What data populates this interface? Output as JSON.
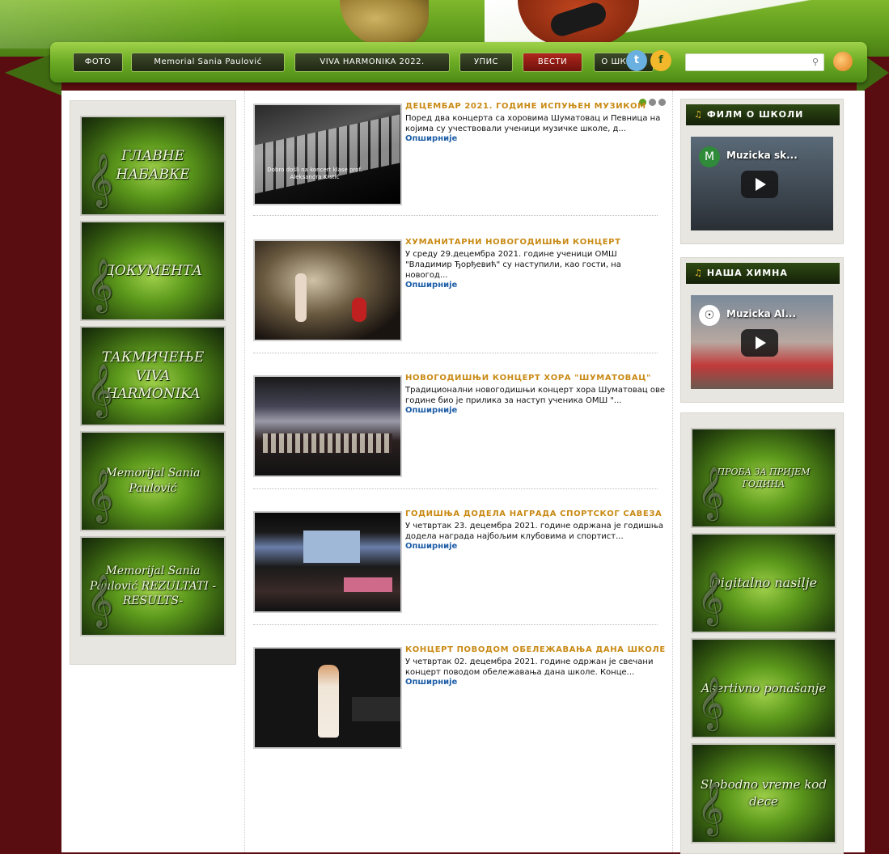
{
  "nav": {
    "items": [
      "ФОТО",
      "Memorial Sania Paulović",
      "VIVA HARMONIKA 2022.",
      "УПИС",
      "ВЕСТИ",
      "О ШКОЛИ"
    ],
    "active_index": 4,
    "search_placeholder": ""
  },
  "left_banners": [
    "ГЛАВНЕ НАБАВКЕ",
    "ДОКУМЕНТА",
    "ТАКМИЧЕЊЕ VIVA HARMONIKA",
    "Memorijal Sania Paulović",
    "Memorijal Sania Paulović REZULTATI -RESULTS-"
  ],
  "articles": [
    {
      "title": "ДЕЦЕМБАР 2021. ГОДИНЕ ИСПУЊЕН МУЗИКОМ",
      "text": "Поред два концерта са хоровима Шуматовац и Певница на којима су учествовали ученици музичке школе, д...",
      "more": "Опширније",
      "thumb_caption": "Dobro došli na koncert klase prof. Aleksandra Krstić"
    },
    {
      "title": "ХУМАНИТАРНИ НОВОГОДИШЊИ КОНЦЕРТ",
      "text": "У среду 29.децембра 2021. године ученици ОМШ \"Владимир Ђорђевић\" су наступили, као гости, на новогод...",
      "more": "Опширније"
    },
    {
      "title": "НОВОГОДИШЊИ КОНЦЕРТ ХОРА \"ШУМАТОВАЦ\"",
      "text": "Традиционални новогодишњи концерт хора Шуматовац ове године био је прилика за наступ ученика ОМШ \"...",
      "more": "Опширније"
    },
    {
      "title": "ГОДИШЊА ДОДЕЛА НАГРАДА СПОРТСКОГ САВЕЗА",
      "text": "У четвртак 23. децембра 2021. године одржана је годишња додела награда најбољим клубовима и спортист...",
      "more": "Опширније"
    },
    {
      "title": "КОНЦЕРТ ПОВОДОМ ОБЕЛЕЖАВАЊА ДАНА ШКОЛЕ",
      "text": "У четвртак 02. децембра 2021. године одржан је свечани концерт поводом обележавања дана школе. Конце...",
      "more": "Опширније"
    }
  ],
  "videos": [
    {
      "heading": "ФИЛМ О ШКОЛИ",
      "title": "Muzicka sk...",
      "avatar": "M"
    },
    {
      "heading": "НАША ХИМНА",
      "title": "Muzicka Al...",
      "avatar": "☉"
    }
  ],
  "right_banners": [
    "ПРОБА ЗА ПРИЈЕМ ГОДИНА",
    "Digitalno nasilje",
    "Asertivno ponašanje",
    "Slobodno vreme kod dece"
  ],
  "colors": {
    "accent_green": "#5d9a1c",
    "title_gold": "#c98a14",
    "link_blue": "#1f5fa8",
    "background_maroon": "#5a0d10",
    "active_nav_red": "#b0261e"
  },
  "icons": {
    "twitter": "twitter-icon",
    "facebook": "facebook-icon",
    "search": "search-icon",
    "rss": "rss-icon",
    "music_note": "music-note-icon"
  }
}
